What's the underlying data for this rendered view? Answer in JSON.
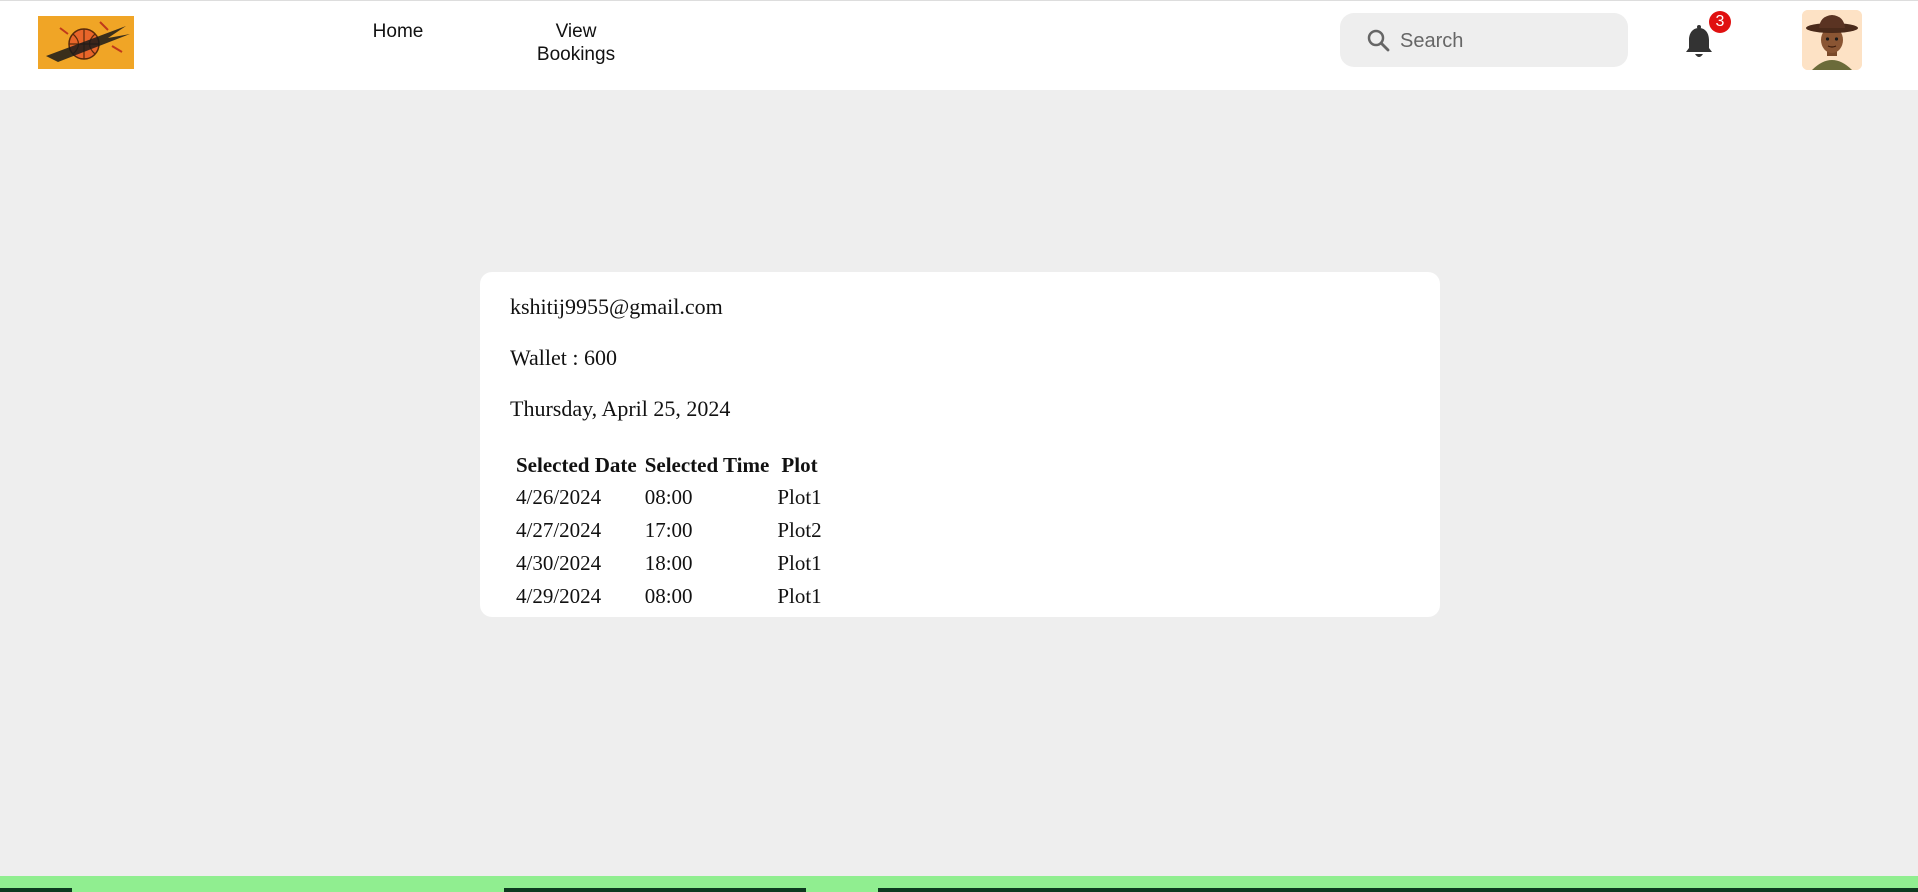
{
  "header": {
    "nav": {
      "home_label": "Home",
      "bookings_label_line1": "View",
      "bookings_label_line2": "Bookings"
    },
    "search": {
      "placeholder": "Search",
      "icon": "search-icon"
    },
    "notifications": {
      "icon": "bell-icon",
      "count": "3"
    },
    "avatar_icon": "avatar-person-with-hat",
    "logo_icon": "basketball-logo"
  },
  "profile": {
    "email": "kshitij9955@gmail.com",
    "wallet_label": "Wallet : 600",
    "date_label": "Thursday, April 25, 2024"
  },
  "bookings": {
    "headers": [
      "Selected Date",
      "Selected Time",
      "Plot"
    ],
    "rows": [
      [
        "4/26/2024",
        "08:00",
        "Plot1"
      ],
      [
        "4/27/2024",
        "17:00",
        "Plot2"
      ],
      [
        "4/30/2024",
        "18:00",
        "Plot1"
      ],
      [
        "4/29/2024",
        "08:00",
        "Plot1"
      ]
    ]
  },
  "colors": {
    "background": "#eeeeee",
    "badge": "#e01010",
    "logo_bg": "#f0a526",
    "bottom_bar": "#90ee90"
  }
}
